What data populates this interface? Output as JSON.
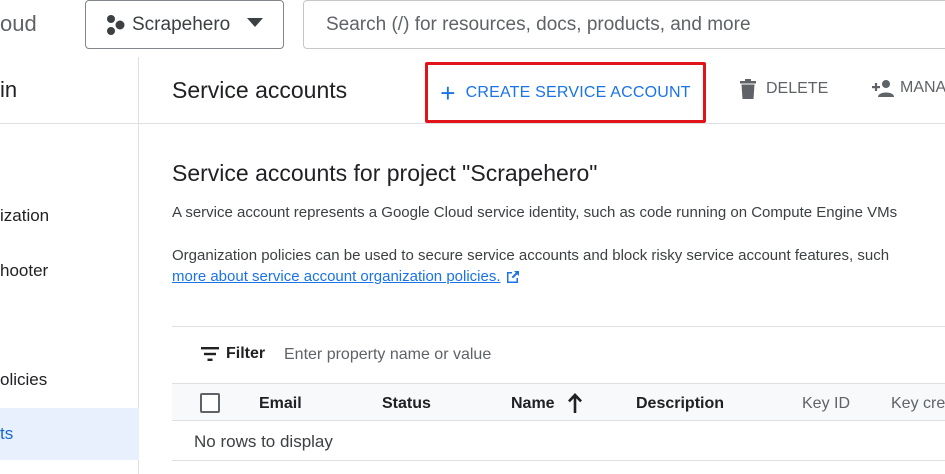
{
  "header": {
    "brand_fragment": "oud",
    "project": "Scrapehero",
    "search_placeholder": "Search (/) for resources, docs, products, and more"
  },
  "sidenav": {
    "title_fragment": "in",
    "items": [
      {
        "label": "ization",
        "active": false
      },
      {
        "label": "hooter",
        "active": false
      },
      {
        "label": "olicies",
        "active": false
      },
      {
        "label": "ts",
        "active": true
      }
    ]
  },
  "toolbar": {
    "page_title": "Service accounts",
    "create_label": "CREATE SERVICE ACCOUNT",
    "delete_label": "DELETE",
    "manage_label": "MANA"
  },
  "main": {
    "section_title": "Service accounts for project \"Scrapehero\"",
    "desc1": "A service account represents a Google Cloud service identity, such as code running on Compute Engine VMs",
    "desc2": "Organization policies can be used to secure service accounts and block risky service account features, such",
    "learn_more": "more about service account organization policies."
  },
  "table": {
    "filter_label": "Filter",
    "filter_placeholder": "Enter property name or value",
    "columns": {
      "email": "Email",
      "status": "Status",
      "name": "Name",
      "description": "Description",
      "key_id": "Key ID",
      "key_created": "Key cre"
    },
    "empty_text": "No rows to display"
  },
  "colors": {
    "accent": "#1a73e8",
    "highlight_border": "#e2141b",
    "active_nav_bg": "#e8f0fe"
  }
}
